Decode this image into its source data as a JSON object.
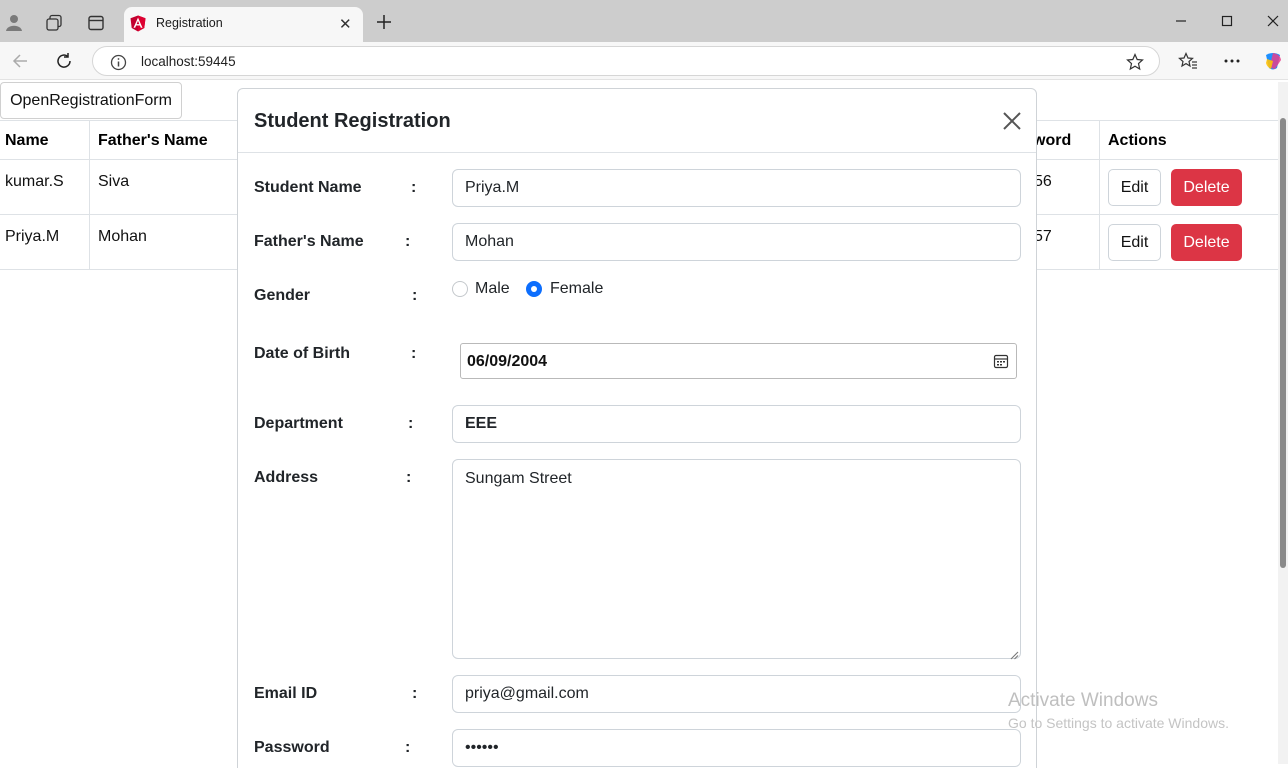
{
  "browser": {
    "tab_title": "Registration",
    "url": "localhost:59445"
  },
  "page": {
    "open_button_label": "OpenRegistrationForm",
    "table": {
      "headers": [
        "Name",
        "Father's Name",
        "word",
        "Actions"
      ],
      "rows": [
        {
          "name": "kumar.S",
          "father_name": "Siva",
          "password_tail": "56",
          "edit": "Edit",
          "delete": "Delete"
        },
        {
          "name": "Priya.M",
          "father_name": "Mohan",
          "password_tail": "57",
          "edit": "Edit",
          "delete": "Delete"
        }
      ]
    }
  },
  "modal": {
    "title": "Student Registration",
    "colon": ":",
    "fields": {
      "student_name": {
        "label": "Student Name",
        "value": "Priya.M"
      },
      "father_name": {
        "label": "Father's Name",
        "value": "Mohan"
      },
      "gender": {
        "label": "Gender",
        "options": [
          "Male",
          "Female"
        ],
        "selected": "Female"
      },
      "dob": {
        "label": "Date of Birth",
        "value": "06/09/2004"
      },
      "department": {
        "label": "Department",
        "value": "EEE"
      },
      "address": {
        "label": "Address",
        "value": "Sungam Street"
      },
      "email": {
        "label": "Email ID",
        "value": "priya@gmail.com"
      },
      "password": {
        "label": "Password",
        "value": "••••••"
      }
    }
  },
  "watermark": {
    "line1": "Activate Windows",
    "line2": "Go to Settings to activate Windows."
  },
  "colors": {
    "primary": "#0d6efd",
    "danger": "#dc3545",
    "border": "#dee2e6"
  }
}
